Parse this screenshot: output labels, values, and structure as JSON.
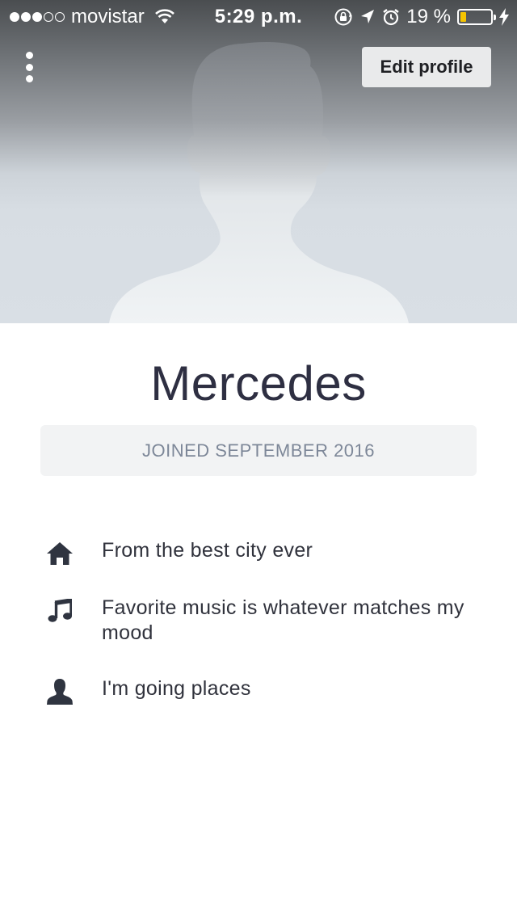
{
  "status_bar": {
    "carrier": "movistar",
    "signal_bars_filled": 3,
    "signal_bars_total": 5,
    "time": "5:29 p.m.",
    "battery_percent_label": "19 %",
    "battery_level": 0.19,
    "battery_color": "#f5c400"
  },
  "header": {
    "menu_icon": "vertical-ellipsis-icon",
    "edit_profile_label": "Edit profile"
  },
  "profile": {
    "name": "Mercedes",
    "joined_label": "JOINED SEPTEMBER 2016",
    "details": [
      {
        "icon": "home-icon",
        "text": "From the best city ever"
      },
      {
        "icon": "music-note-icon",
        "text": "Favorite music is whatever matches my mood"
      },
      {
        "icon": "person-icon",
        "text": "I'm going places"
      }
    ]
  },
  "colors": {
    "name_text": "#2e2f42",
    "joined_text": "#7d8798",
    "icon": "#2f3440"
  }
}
